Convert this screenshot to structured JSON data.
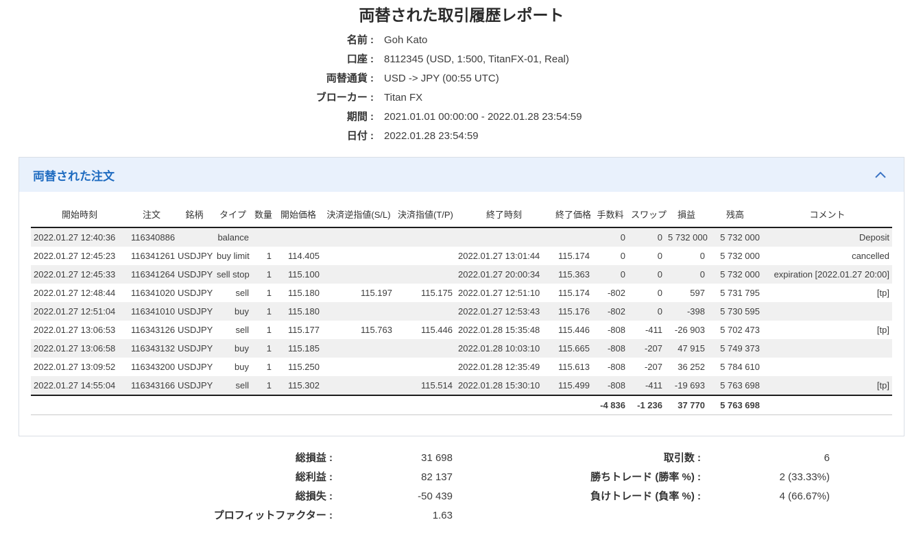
{
  "report": {
    "title": "両替された取引履歴レポート",
    "info": [
      {
        "label": "名前 :",
        "value": "Goh Kato"
      },
      {
        "label": "口座 :",
        "value": "8112345 (USD, 1:500, TitanFX-01, Real)"
      },
      {
        "label": "両替通貨 :",
        "value": "USD -> JPY (00:55 UTC)"
      },
      {
        "label": "ブローカー :",
        "value": "Titan FX"
      },
      {
        "label": "期間 :",
        "value": "2021.01.01 00:00:00 - 2022.01.28 23:54:59"
      },
      {
        "label": "日付 :",
        "value": "2022.01.28 23:54:59"
      }
    ]
  },
  "orders_panel": {
    "title": "両替された注文",
    "collapse_icon": "chevron-up",
    "table": {
      "headers": [
        "開始時刻",
        "注文",
        "銘柄",
        "タイプ",
        "数量",
        "開始価格",
        "決済逆指値(S/L)",
        "決済指値(T/P)",
        "終了時刻",
        "終了価格",
        "手数料",
        "スワップ",
        "損益",
        "残高",
        "コメント"
      ],
      "col_aligns": [
        "left",
        "right",
        "left",
        "right",
        "right",
        "right",
        "right",
        "right",
        "left",
        "right",
        "right",
        "right",
        "right",
        "right",
        "right"
      ],
      "rows": [
        [
          "2022.01.27 12:40:36",
          "116340886",
          "",
          "balance",
          "",
          "",
          "",
          "",
          "",
          "",
          "0",
          "0",
          "5 732 000",
          "5 732 000",
          "Deposit"
        ],
        [
          "2022.01.27 12:45:23",
          "116341261",
          "USDJPY",
          "buy limit",
          "1",
          "114.405",
          "",
          "",
          "2022.01.27 13:01:44",
          "115.174",
          "0",
          "0",
          "0",
          "5 732 000",
          "cancelled"
        ],
        [
          "2022.01.27 12:45:33",
          "116341264",
          "USDJPY",
          "sell stop",
          "1",
          "115.100",
          "",
          "",
          "2022.01.27 20:00:34",
          "115.363",
          "0",
          "0",
          "0",
          "5 732 000",
          "expiration [2022.01.27 20:00]"
        ],
        [
          "2022.01.27 12:48:44",
          "116341020",
          "USDJPY",
          "sell",
          "1",
          "115.180",
          "115.197",
          "115.175",
          "2022.01.27 12:51:10",
          "115.174",
          "-802",
          "0",
          "597",
          "5 731 795",
          "[tp]"
        ],
        [
          "2022.01.27 12:51:04",
          "116341010",
          "USDJPY",
          "buy",
          "1",
          "115.180",
          "",
          "",
          "2022.01.27 12:53:43",
          "115.176",
          "-802",
          "0",
          "-398",
          "5 730 595",
          ""
        ],
        [
          "2022.01.27 13:06:53",
          "116343126",
          "USDJPY",
          "sell",
          "1",
          "115.177",
          "115.763",
          "115.446",
          "2022.01.28 15:35:48",
          "115.446",
          "-808",
          "-411",
          "-26 903",
          "5 702 473",
          "[tp]"
        ],
        [
          "2022.01.27 13:06:58",
          "116343132",
          "USDJPY",
          "buy",
          "1",
          "115.185",
          "",
          "",
          "2022.01.28 10:03:10",
          "115.665",
          "-808",
          "-207",
          "47 915",
          "5 749 373",
          ""
        ],
        [
          "2022.01.27 13:09:52",
          "116343200",
          "USDJPY",
          "buy",
          "1",
          "115.250",
          "",
          "",
          "2022.01.28 12:35:49",
          "115.613",
          "-808",
          "-207",
          "36 252",
          "5 784 610",
          ""
        ],
        [
          "2022.01.27 14:55:04",
          "116343166",
          "USDJPY",
          "sell",
          "1",
          "115.302",
          "",
          "115.514",
          "2022.01.28 15:30:10",
          "115.499",
          "-808",
          "-411",
          "-19 693",
          "5 763 698",
          "[tp]"
        ]
      ],
      "totals": {
        "commission": "-4 836",
        "swap": "-1 236",
        "profit": "37 770",
        "balance": "5 763 698"
      }
    }
  },
  "summary": {
    "left": [
      {
        "label": "総損益 :",
        "value": "31 698"
      },
      {
        "label": "総利益 :",
        "value": "82 137"
      },
      {
        "label": "総損失 :",
        "value": "-50 439"
      },
      {
        "label": "プロフィットファクター :",
        "value": "1.63"
      }
    ],
    "right": [
      {
        "label": "取引数 :",
        "value": "6"
      },
      {
        "label": "勝ちトレード (勝率 %) :",
        "value": "2 (33.33%)"
      },
      {
        "label": "負けトレード (負率 %) :",
        "value": "4 (66.67%)"
      }
    ]
  },
  "colors": {
    "accent_blue": "#1e6bc0",
    "panel_header_bg": "#e9f1fc",
    "stripe_gray": "#f0f0f0"
  }
}
